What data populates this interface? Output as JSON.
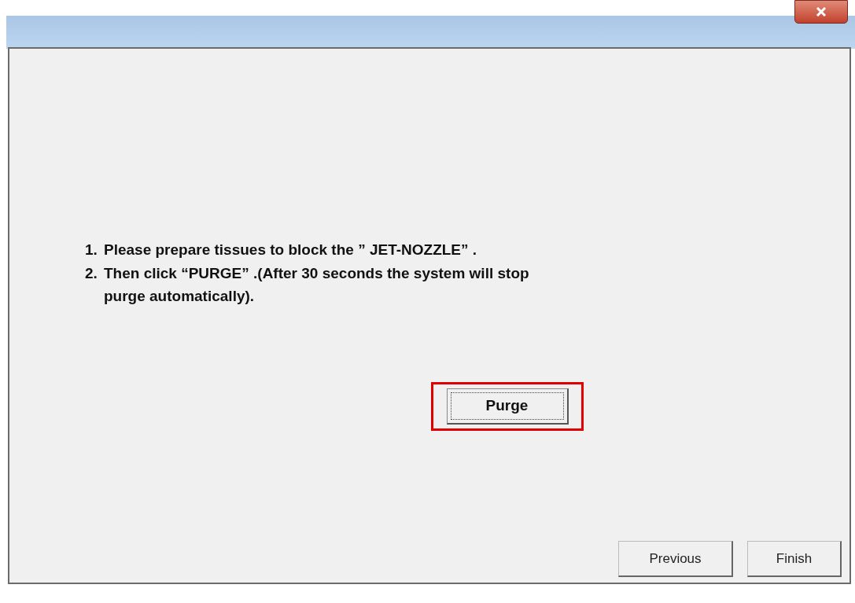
{
  "instructions": [
    {
      "number": "1.",
      "text": "Please prepare tissues to block the ” JET-NOZZLE” ."
    },
    {
      "number": "2.",
      "text": "Then click “PURGE” .(After 30 seconds the system will stop purge automatically)."
    }
  ],
  "purge_button": {
    "label": "Purge",
    "focused": true,
    "highlighted": true
  },
  "buttons": [
    {
      "label": "Previous"
    },
    {
      "label": "Finish"
    }
  ]
}
